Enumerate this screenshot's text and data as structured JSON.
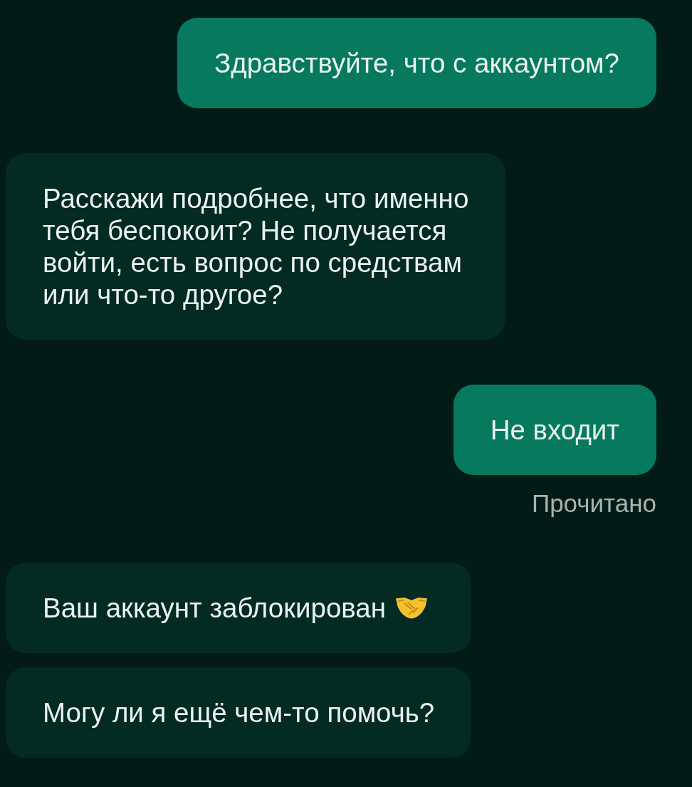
{
  "messages": [
    {
      "kind": "outgoing",
      "text": "Здравствуйте, что с аккаунтом?"
    },
    {
      "kind": "incoming",
      "text": "Расскажи подробнее, что именно\nтебя беспокоит? Не получается\nвойти, есть вопрос по средствам\nили что-то другое?"
    },
    {
      "kind": "outgoing",
      "text": "Не входит",
      "status": "Прочитано"
    },
    {
      "kind": "incoming",
      "text": "Ваш аккаунт заблокирован",
      "handshake_emoji": true
    },
    {
      "kind": "incoming",
      "text": "Могу ли я ещё чем-то помочь?"
    }
  ]
}
